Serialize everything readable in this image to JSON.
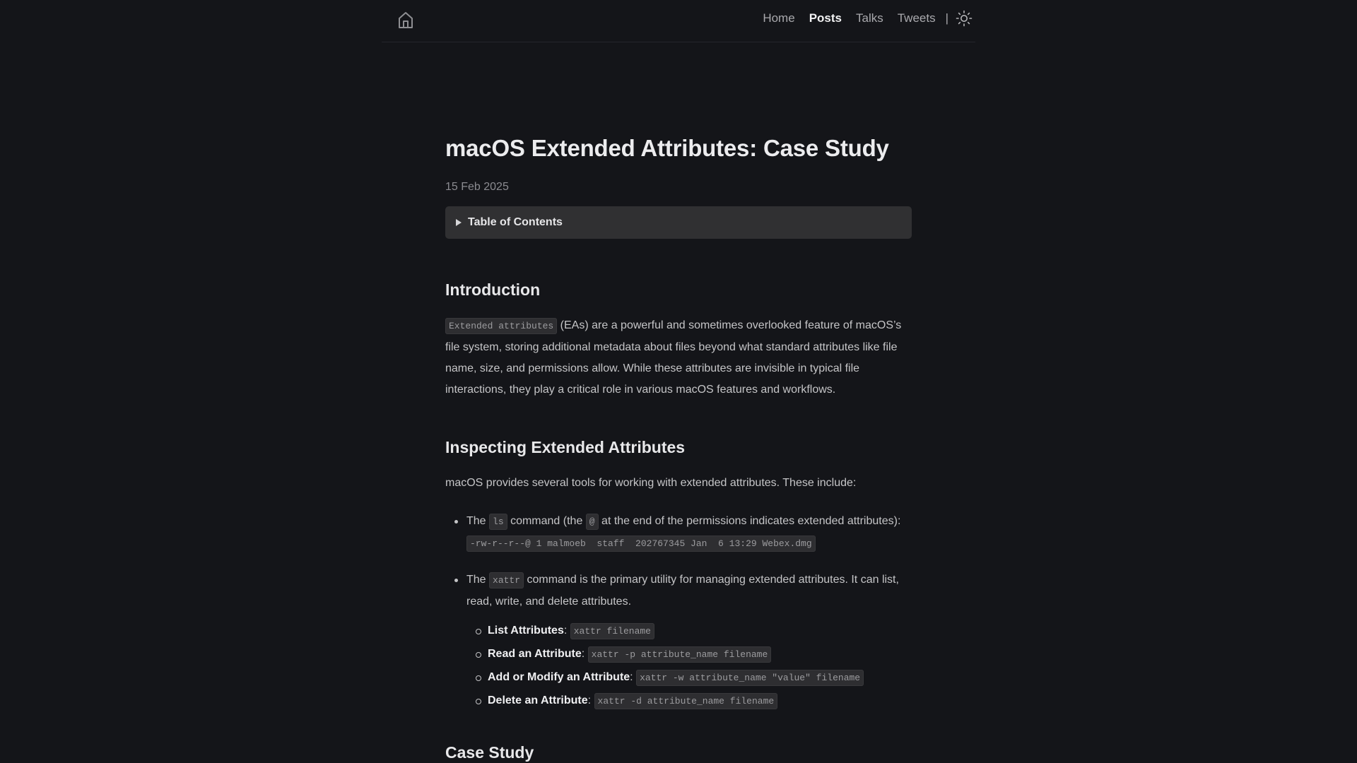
{
  "header": {
    "home_icon": "home-icon",
    "nav": [
      {
        "label": "Home",
        "active": false
      },
      {
        "label": "Posts",
        "active": true
      },
      {
        "label": "Talks",
        "active": false
      },
      {
        "label": "Tweets",
        "active": false
      }
    ],
    "separator": "|",
    "theme_icon": "sun-icon"
  },
  "article": {
    "title": "macOS Extended Attributes: Case Study",
    "date": "15 Feb 2025",
    "toc_label": "Table of Contents",
    "intro": {
      "heading": "Introduction",
      "code": "Extended attributes",
      "text": " (EAs) are a powerful and sometimes overlooked feature of macOS’s file system, storing additional metadata about files beyond what standard attributes like file name, size, and permissions allow. While these attributes are invisible in typical file interactions, they play a critical role in various macOS features and workflows."
    },
    "inspecting": {
      "heading": "Inspecting Extended Attributes",
      "lead": "macOS provides several tools for working with extended attributes. These include:",
      "ls_item": {
        "prefix": "The ",
        "code": "ls",
        "middle": " command (the ",
        "code2": "@",
        "suffix": " at the end of the permissions indicates extended attributes):",
        "output": "-rw-r--r--@ 1 malmoeb  staff  202767345 Jan  6 13:29 Webex.dmg"
      },
      "xattr_item": {
        "prefix": "The ",
        "code": "xattr",
        "suffix": " command is the primary utility for managing extended attributes. It can list, read, write, and delete attributes.",
        "subitems": [
          {
            "label": "List Attributes",
            "code": "xattr filename"
          },
          {
            "label": "Read an Attribute",
            "code": "xattr -p attribute_name filename"
          },
          {
            "label": "Add or Modify an Attribute",
            "code": "xattr -w attribute_name \"value\" filename"
          },
          {
            "label": "Delete an Attribute",
            "code": "xattr -d attribute_name filename"
          }
        ]
      }
    },
    "case_study": {
      "heading": "Case Study"
    }
  }
}
